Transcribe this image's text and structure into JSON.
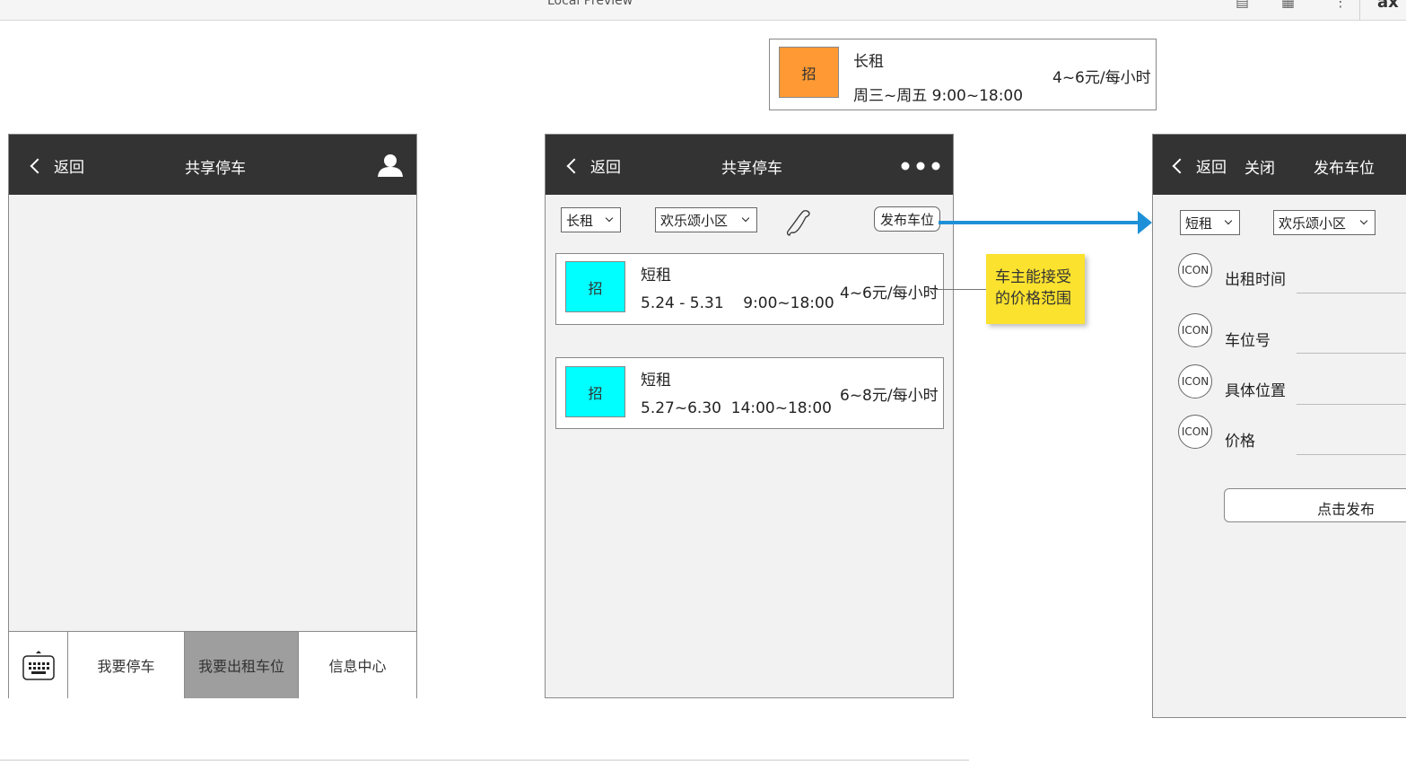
{
  "browser": {
    "title": "Local Preview",
    "logo": "ax"
  },
  "screen1": {
    "nav": {
      "back": "返回",
      "title": "共享停车"
    },
    "tabs": [
      "我要停车",
      "我要出租车位",
      "信息中心"
    ]
  },
  "top_card": {
    "badge": "招",
    "type": "长租",
    "schedule": "周三~周五  9:00~18:00",
    "price": "4~6元/每小时",
    "badge_color": "#ff9933"
  },
  "screen2": {
    "nav": {
      "back": "返回",
      "title": "共享停车"
    },
    "filter_type": "长租",
    "filter_community": "欢乐颂小区",
    "publish_button": "发布车位",
    "listings": [
      {
        "badge": "招",
        "type": "短租",
        "schedule": "5.24 - 5.31    9:00~18:00",
        "price": "4~6元/每小时"
      },
      {
        "badge": "招",
        "type": "短租",
        "schedule": "5.27~6.30  14:00~18:00",
        "price": "6~8元/每小时"
      }
    ],
    "badge_color": "#00ffff"
  },
  "note": {
    "text_line1": "车主能接受",
    "text_line2": "的价格范围"
  },
  "screen3": {
    "nav": {
      "back": "返回",
      "close": "关闭",
      "title": "发布车位"
    },
    "filter_type": "短租",
    "filter_community": "欢乐颂小区",
    "fields": [
      {
        "icon": "ICON",
        "label": "出租时间"
      },
      {
        "icon": "ICON",
        "label": "车位号"
      },
      {
        "icon": "ICON",
        "label": "具体位置"
      },
      {
        "icon": "ICON",
        "label": "价格"
      }
    ],
    "submit": "点击发布"
  },
  "colors": {
    "navbar": "#333333",
    "arrow": "#1e90d8",
    "note": "#fbe22e",
    "active_tab": "#9e9e9e"
  }
}
